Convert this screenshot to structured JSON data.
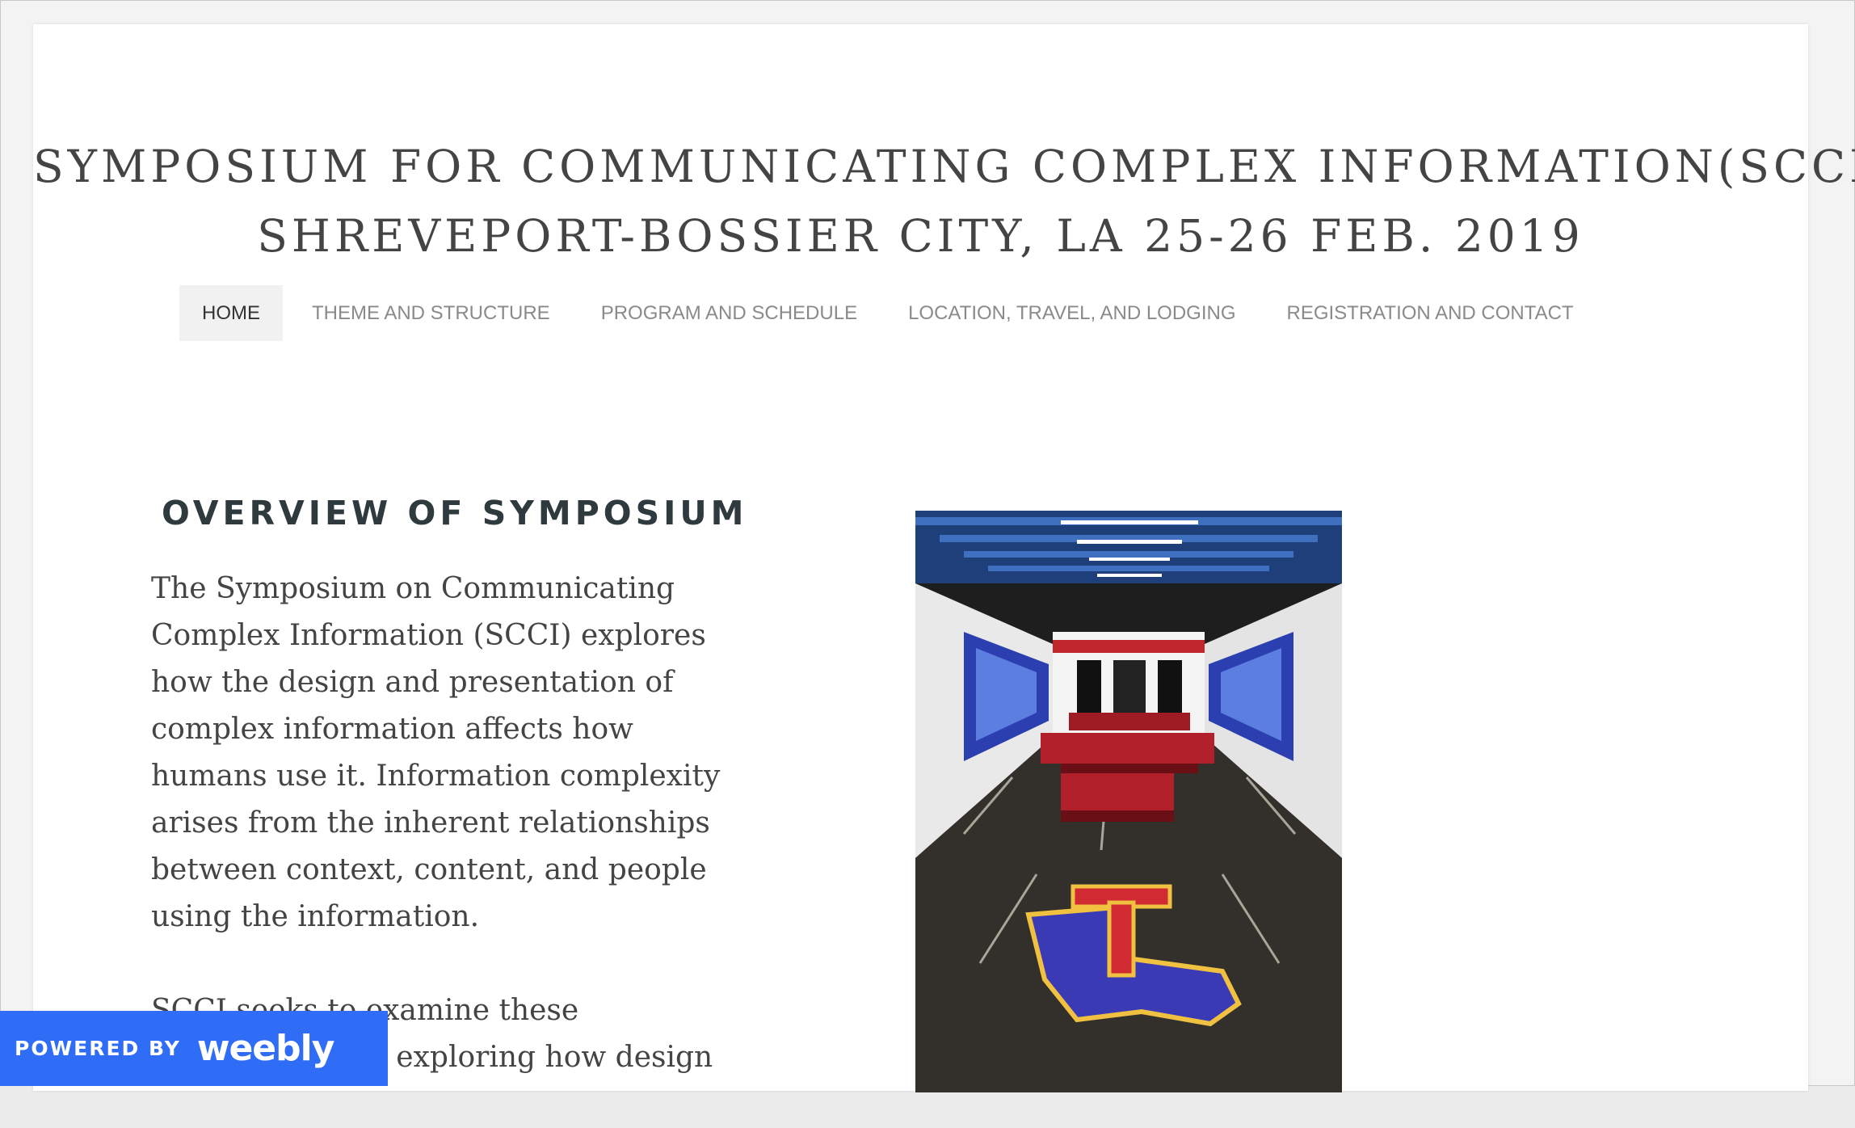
{
  "header": {
    "title_line1": "SYMPOSIUM FOR COMMUNICATING COMPLEX INFORMATION(SCCI)",
    "title_line2": "SHREVEPORT-BOSSIER CITY, LA 25-26 FEB. 2019"
  },
  "nav": {
    "items": [
      {
        "label": "HOME",
        "active": true
      },
      {
        "label": "THEME AND STRUCTURE"
      },
      {
        "label": "PROGRAM AND SCHEDULE"
      },
      {
        "label": "LOCATION, TRAVEL, AND LODGING"
      },
      {
        "label": "REGISTRATION AND CONTACT"
      }
    ]
  },
  "main": {
    "heading": "OVERVIEW OF SYMPOSIUM",
    "paragraph1": "The Symposium on Communicating Complex Information (SCCI) explores how the design and presentation of complex information affects how humans use it. Information complexity arises from the inherent relationships between context, content, and people using the information.",
    "paragraph2": "SCCI seeks to examine these relationships by exploring how design"
  },
  "photo": {
    "icon": "lobby-photo",
    "floor_logo_text": "LT"
  },
  "badge": {
    "powered_label": "POWERED BY",
    "brand": "weebly",
    "color": "#2f6df6"
  }
}
